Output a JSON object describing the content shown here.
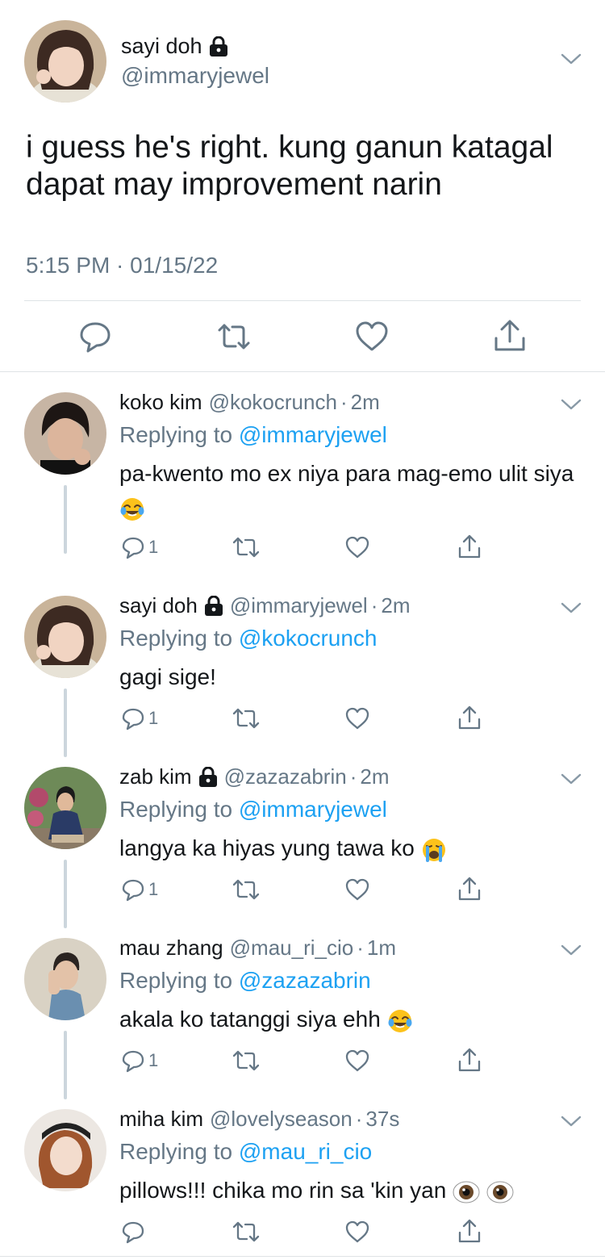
{
  "main_tweet": {
    "name": "sayi doh",
    "handle": "@immaryjewel",
    "text": "i guess he's right. kung ganun katagal dapat may improvement narin",
    "timestamp": "5:15 PM · 01/15/22",
    "locked": true
  },
  "replies": [
    {
      "name": "koko kim",
      "handle": "@kokocrunch",
      "dot": "·",
      "time": "2m",
      "replying_label": "Replying to",
      "replying_to": "@immaryjewel",
      "text": "pa-kwento mo ex niya para mag-emo ulit siya",
      "emojis": [
        "laughing-tears"
      ],
      "reply_count": "1",
      "locked": false
    },
    {
      "name": "sayi doh",
      "handle": "@immaryjewel",
      "dot": "·",
      "time": "2m",
      "replying_label": "Replying to",
      "replying_to": "@kokocrunch",
      "text": "gagi sige!",
      "emojis": [],
      "reply_count": "1",
      "locked": true
    },
    {
      "name": "zab kim",
      "handle": "@zazazabrin",
      "dot": "·",
      "time": "2m",
      "replying_label": "Replying to",
      "replying_to": "@immaryjewel",
      "text": "langya ka hiyas yung tawa ko",
      "emojis": [
        "crying-loudly"
      ],
      "reply_count": "1",
      "locked": true
    },
    {
      "name": "mau zhang",
      "handle": "@mau_ri_cio",
      "dot": "·",
      "time": "1m",
      "replying_label": "Replying to",
      "replying_to": "@zazazabrin",
      "text": "akala ko tatanggi siya ehh",
      "emojis": [
        "laughing-tears"
      ],
      "reply_count": "1",
      "locked": false
    },
    {
      "name": "miha kim",
      "handle": "@lovelyseason",
      "dot": "·",
      "time": "37s",
      "replying_label": "Replying to",
      "replying_to": "@mau_ri_cio",
      "text": "pillows!!! chika mo rin sa 'kin yan",
      "emojis": [
        "eye",
        "eye"
      ],
      "reply_count": "",
      "locked": false
    }
  ],
  "icons": {
    "reply": "reply-icon",
    "retweet": "retweet-icon",
    "like": "like-icon",
    "share": "share-icon",
    "caret": "chevron-down-icon",
    "lock": "lock-icon"
  },
  "colors": {
    "link": "#1da1f2",
    "secondary_text": "#657786",
    "icon": "#657786",
    "divider": "#dfe3e6"
  }
}
